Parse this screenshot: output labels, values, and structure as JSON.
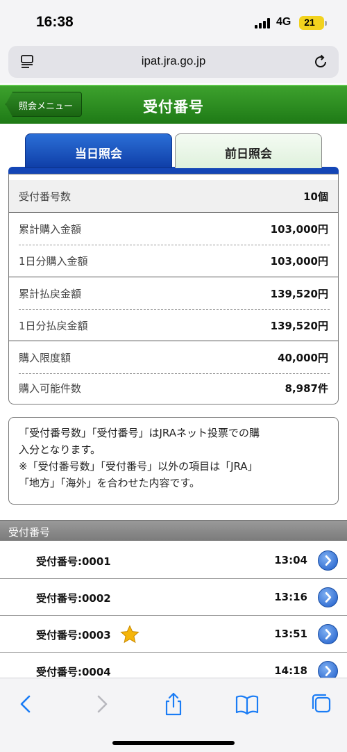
{
  "status_bar": {
    "time": "16:38",
    "network": "4G",
    "battery": "21"
  },
  "browser": {
    "url": "ipat.jra.go.jp"
  },
  "header": {
    "back_label": "照会メニュー",
    "title": "受付番号"
  },
  "tabs": [
    {
      "label": "当日照会",
      "active": true
    },
    {
      "label": "前日照会",
      "active": false
    }
  ],
  "summary": [
    {
      "label": "受付番号数",
      "value": "10個"
    },
    {
      "label": "累計購入金額",
      "value": "103,000円"
    },
    {
      "label": "1日分購入金額",
      "value": "103,000円"
    },
    {
      "label": "累計払戻金額",
      "value": "139,520円"
    },
    {
      "label": "1日分払戻金額",
      "value": "139,520円"
    },
    {
      "label": "購入限度額",
      "value": "40,000円"
    },
    {
      "label": "購入可能件数",
      "value": "8,987件"
    }
  ],
  "note": {
    "line1": "「受付番号数」「受付番号」はJRAネット投票での購",
    "line2": "入分となります。",
    "line3": "※「受付番号数」「受付番号」以外の項目は「JRA」",
    "line4": "「地方」「海外」を合わせた内容です。"
  },
  "section_title": "受付番号",
  "receipts": [
    {
      "label": "受付番号:0001",
      "time": "13:04",
      "starred": false
    },
    {
      "label": "受付番号:0002",
      "time": "13:16",
      "starred": false
    },
    {
      "label": "受付番号:0003",
      "time": "13:51",
      "starred": true
    },
    {
      "label": "受付番号:0004",
      "time": "14:18",
      "starred": false
    }
  ],
  "colors": {
    "header_green": "#2e8b22",
    "tab_blue": "#1446b6",
    "ios_blue": "#1a7cf5",
    "star_gold": "#f5b50a"
  },
  "icons": [
    "reader-icon",
    "reload-icon",
    "chevron-right-icon",
    "star-icon",
    "back-icon",
    "forward-icon",
    "share-icon",
    "bookmarks-icon",
    "tabs-icon"
  ]
}
